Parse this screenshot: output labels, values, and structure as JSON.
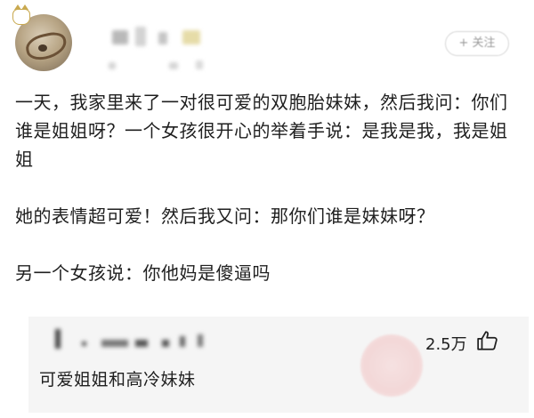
{
  "header": {
    "follow_label": "+ 关注"
  },
  "post": {
    "paragraph_1": "一天，我家里来了一对很可爱的双胞胎妹妹，然后我问：你们谁是姐姐呀？一个女孩很开心的举着手说：是我是我，我是姐姐",
    "paragraph_2": "她的表情超可爱！然后我又问：那你们谁是妹妹呀？",
    "paragraph_3": "另一个女孩说：你他妈是傻逼吗"
  },
  "comment": {
    "likes": "2.5万",
    "text": "可爱姐姐和高冷妹妹"
  },
  "icons": {
    "like": "thumbs-up-icon",
    "avatar_badge": "cat-badge-icon"
  }
}
